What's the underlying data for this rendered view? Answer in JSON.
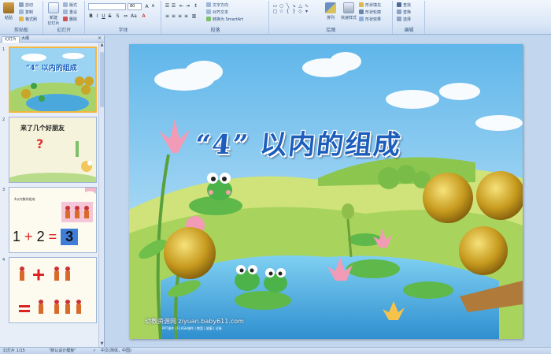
{
  "ribbon": {
    "clipboard": {
      "label": "剪贴板",
      "paste": "粘贴",
      "cut": "剪切",
      "copy": "复制",
      "format_painter": "格式刷"
    },
    "slides": {
      "label": "幻灯片",
      "new_slide": "新建\n幻灯片",
      "layout": "版式",
      "reset": "重设",
      "delete": "删除"
    },
    "font": {
      "label": "字体",
      "font_name": "",
      "font_size": "80"
    },
    "paragraph": {
      "label": "段落",
      "text_direction": "文字方向",
      "align_text": "对齐文本",
      "smartart": "转换为 SmartArt"
    },
    "drawing": {
      "label": "绘图",
      "arrange": "排列",
      "quick_styles": "快速样式",
      "shape_fill": "形状填充",
      "shape_outline": "形状轮廓",
      "shape_effects": "形状效果"
    },
    "editing": {
      "label": "编辑",
      "find": "查找",
      "replace": "替换",
      "select": "选择"
    }
  },
  "pane": {
    "tab_slides": "幻灯片",
    "tab_outline": "大纲",
    "thumbs": [
      {
        "num": "1",
        "title": "“4” 以内的组成"
      },
      {
        "num": "2",
        "title": "来了几个好朋友",
        "mark": "?"
      },
      {
        "num": "3",
        "small": "4以内数的组成",
        "eq_a": "1",
        "eq_b": "2",
        "eq_c": "3"
      },
      {
        "num": "4"
      }
    ]
  },
  "slide": {
    "title": "“4” 以内的组成",
    "watermark": "幼教资源网 ziyuan.baby611.com",
    "watermark_sub": "PPT课件 | FLASH课件 | 教案 | 故事 | 试卷"
  },
  "status": {
    "slide_info": "幻灯片 1/15",
    "theme": "\"默认设计模板\"",
    "language": "中文(简体，中国)"
  },
  "colors": {
    "accent": "#1d5ebd",
    "ribbon_bg": "#dbe7f7",
    "selection": "#f3b742"
  }
}
